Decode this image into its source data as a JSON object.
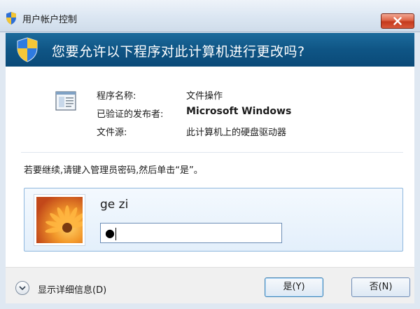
{
  "window": {
    "title": "用户帐户控制",
    "close_icon": "close-icon"
  },
  "header": {
    "question": "您要允许以下程序对此计算机进行更改吗?"
  },
  "program_info": {
    "name_label": "程序名称:",
    "name_value": "文件操作",
    "publisher_label": "已验证的发布者:",
    "publisher_value": "Microsoft Windows",
    "source_label": "文件源:",
    "source_value": "此计算机上的硬盘驱动器"
  },
  "instruction": "若要继续,请键入管理员密码,然后单击“是”。",
  "credential": {
    "username": "ge zi",
    "password_value": "●"
  },
  "footer": {
    "details_label": "显示详细信息(D)",
    "yes_label": "是(Y)",
    "no_label": "否(N)"
  },
  "colors": {
    "header_bg": "#0f5585",
    "close_btn": "#d8583a",
    "tile_border": "#8fb8de"
  }
}
